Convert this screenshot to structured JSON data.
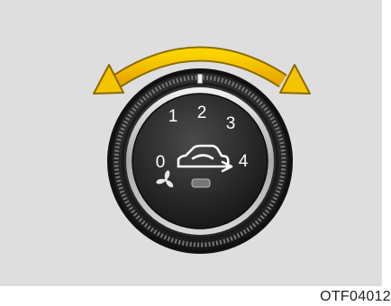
{
  "knob": {
    "positions": [
      "0",
      "1",
      "2",
      "3",
      "4"
    ],
    "fan_icon": "fan-icon",
    "mode_icon": "recirculation-car-icon",
    "indicator": "indicator-lamp",
    "rotation_arrow_icon": "double-headed-curved-arrow-icon",
    "arrow_color": "#f5c400"
  },
  "figure_code": "OTF04012"
}
